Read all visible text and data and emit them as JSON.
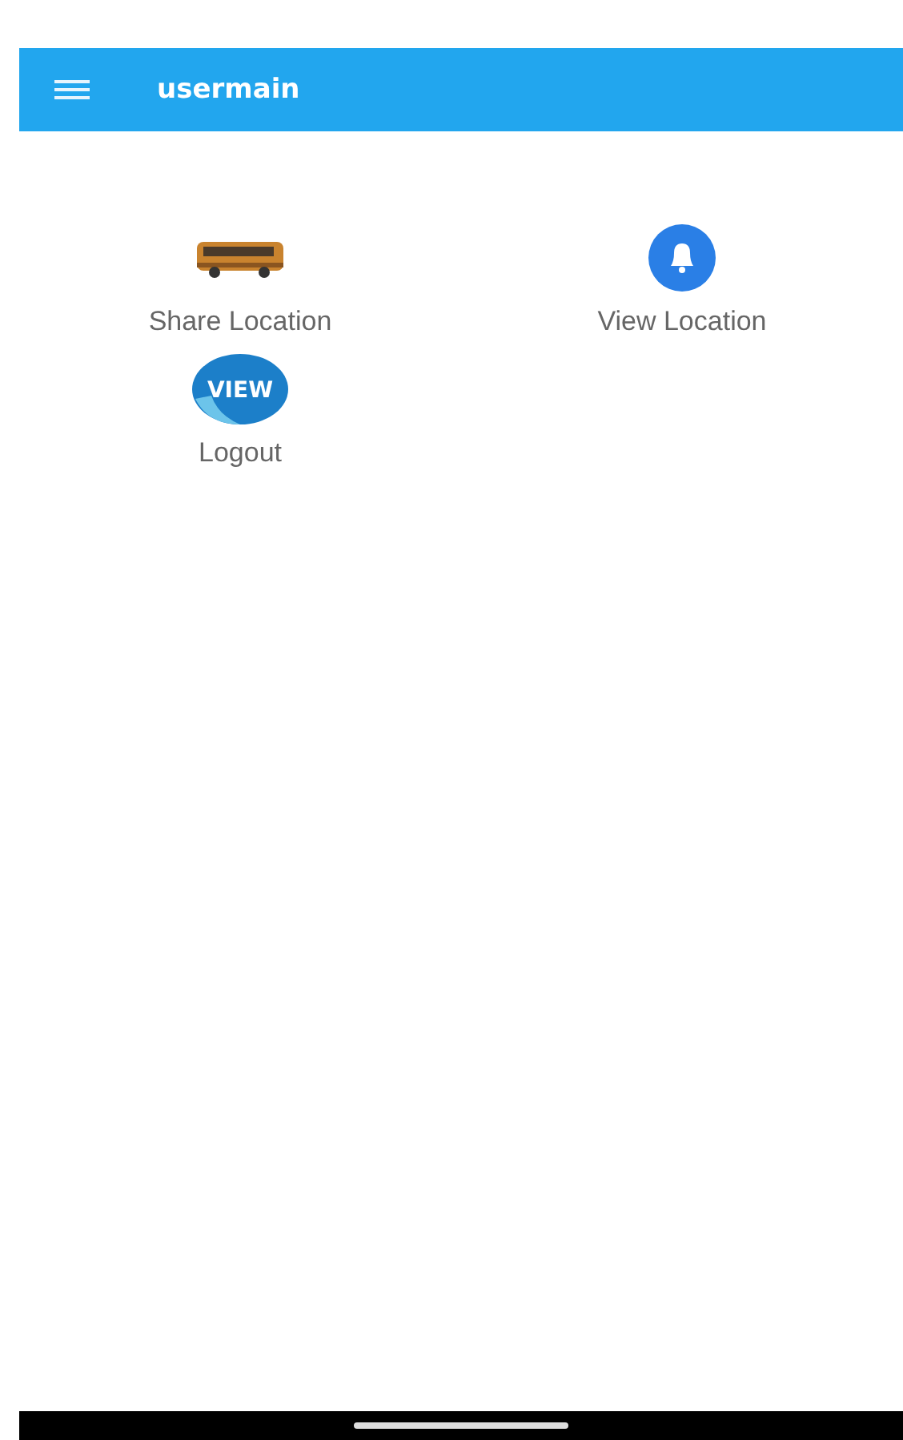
{
  "app_bar": {
    "title": "usermain"
  },
  "menu_items": [
    {
      "label": "Share Location"
    },
    {
      "label": "View Location"
    },
    {
      "label": "Logout",
      "icon_text": "VIEW"
    }
  ]
}
